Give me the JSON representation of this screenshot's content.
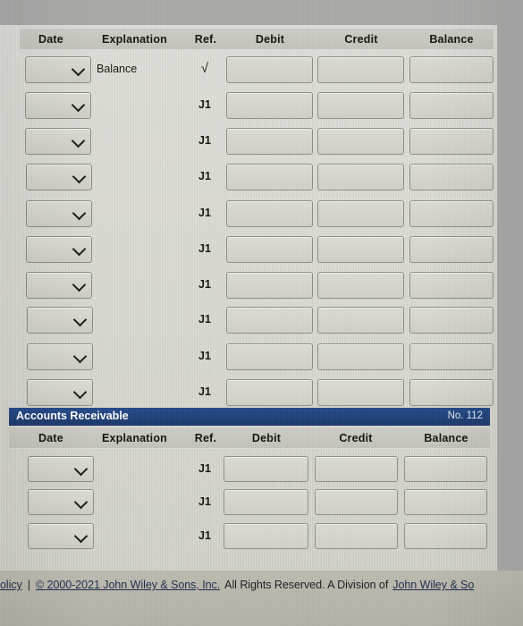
{
  "columns": [
    "Date",
    "Explanation",
    "Ref.",
    "Debit",
    "Credit",
    "Balance"
  ],
  "accounts": [
    {
      "name": "",
      "number": "",
      "show_account_bar": false,
      "columns": [
        "Date",
        "Explanation",
        "Ref.",
        "Debit",
        "Credit",
        "Balance"
      ],
      "rows": [
        {
          "date": "",
          "explanation": "Balance",
          "ref": "√",
          "debit": "",
          "credit": "",
          "balance": ""
        },
        {
          "date": "",
          "explanation": "",
          "ref": "J1",
          "debit": "",
          "credit": "",
          "balance": ""
        },
        {
          "date": "",
          "explanation": "",
          "ref": "J1",
          "debit": "",
          "credit": "",
          "balance": ""
        },
        {
          "date": "",
          "explanation": "",
          "ref": "J1",
          "debit": "",
          "credit": "",
          "balance": ""
        },
        {
          "date": "",
          "explanation": "",
          "ref": "J1",
          "debit": "",
          "credit": "",
          "balance": ""
        },
        {
          "date": "",
          "explanation": "",
          "ref": "J1",
          "debit": "",
          "credit": "",
          "balance": ""
        },
        {
          "date": "",
          "explanation": "",
          "ref": "J1",
          "debit": "",
          "credit": "",
          "balance": ""
        },
        {
          "date": "",
          "explanation": "",
          "ref": "J1",
          "debit": "",
          "credit": "",
          "balance": ""
        },
        {
          "date": "",
          "explanation": "",
          "ref": "J1",
          "debit": "",
          "credit": "",
          "balance": ""
        },
        {
          "date": "",
          "explanation": "",
          "ref": "J1",
          "debit": "",
          "credit": "",
          "balance": ""
        }
      ]
    },
    {
      "name": "Accounts Receivable",
      "number": "No. 112",
      "show_account_bar": true,
      "columns": [
        "Date",
        "Explanation",
        "Ref.",
        "Debit",
        "Credit",
        "Balance"
      ],
      "rows": [
        {
          "date": "",
          "explanation": "",
          "ref": "J1",
          "debit": "",
          "credit": "",
          "balance": ""
        },
        {
          "date": "",
          "explanation": "",
          "ref": "J1",
          "debit": "",
          "credit": "",
          "balance": ""
        },
        {
          "date": "",
          "explanation": "",
          "ref": "J1",
          "debit": "",
          "credit": "",
          "balance": ""
        }
      ]
    }
  ],
  "footer": {
    "privacy_link": "olicy",
    "separator": "|",
    "copyright_link": "© 2000-2021 John Wiley & Sons, Inc.",
    "rights_text": "All Rights Reserved. A Division of",
    "division_link": "John Wiley & So"
  },
  "colors": {
    "account_bar": "#1f3f7a",
    "column_header_bar": "#c6c5bf",
    "page_background": "#d9d8d2",
    "outer_background": "#a9aaa8",
    "footer_background": "#b7b5a9",
    "link": "#1c2a4d"
  }
}
